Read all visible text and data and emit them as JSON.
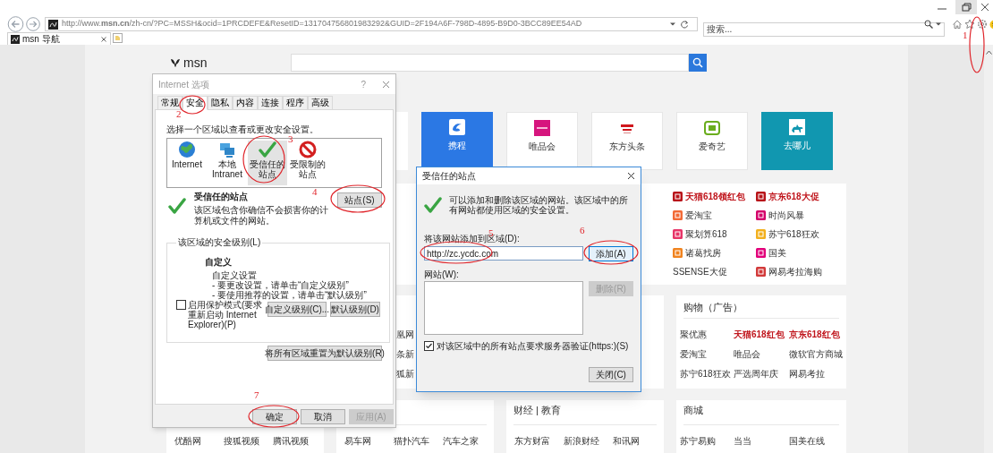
{
  "browser": {
    "address": "http://www.**msn.cn**/zh-cn/?PC=MSSH&ocid=1PRCDEFE&ResetID=131704756801983292&GUID=2F194A6F-798D-4895-B9D0-3BCC89EE54AD",
    "search_placeholder": "搜索...",
    "tabs": [
      {
        "label": "msn 导航",
        "selected": true
      }
    ]
  },
  "page": {
    "logo": "msn",
    "tiles": [
      {
        "label": "携程",
        "color": "#2b78e4"
      },
      {
        "label": "唯品会",
        "color": "#ffffff"
      },
      {
        "label": "东方头条",
        "color": "#ffffff"
      },
      {
        "label": "爱奇艺",
        "color": "#ffffff"
      },
      {
        "label": "去哪儿",
        "color": "#1197b0"
      }
    ],
    "promos": [
      {
        "label": "天猫618领红包",
        "highlight": true,
        "color": "#b8141a"
      },
      {
        "label": "京东618大促",
        "highlight": true,
        "color": "#b8141a"
      },
      {
        "label": "爱淘宝",
        "highlight": false,
        "color": "#f26a36"
      },
      {
        "label": "时尚风暴",
        "highlight": false,
        "color": "#d4006a"
      },
      {
        "label": "聚划算618",
        "highlight": false,
        "color": "#e73568"
      },
      {
        "label": "苏宁618狂欢",
        "highlight": false,
        "color": "#f2b01e"
      },
      {
        "label": "诸葛找房",
        "highlight": false,
        "color": "#f0831f"
      },
      {
        "label": "国美",
        "highlight": false,
        "color": "#e2007a"
      },
      {
        "label": "SSENSE大促",
        "highlight": false
      },
      {
        "label": "网易考拉海购",
        "highlight": false,
        "color": "#d23a3a"
      }
    ],
    "partial_links": [
      "凰网",
      "条新",
      "狐新"
    ],
    "shopping": {
      "title": "购物（广告）",
      "links": [
        {
          "label": "聚优惠",
          "highlight": false
        },
        {
          "label": "天猫618红包",
          "highlight": true
        },
        {
          "label": "京东618红包",
          "highlight": true
        },
        {
          "label": "爱淘宝",
          "highlight": false
        },
        {
          "label": "唯品会",
          "highlight": false
        },
        {
          "label": "微软官方商城",
          "highlight": false
        },
        {
          "label": "苏宁618狂欢",
          "highlight": false
        },
        {
          "label": "严选周年庆",
          "highlight": false
        },
        {
          "label": "网易考拉",
          "highlight": false
        }
      ]
    },
    "sections": [
      {
        "links": [
          "优酷网",
          "搜狐视频",
          "腾讯视频"
        ]
      },
      {
        "links": [
          "易车网",
          "猫扑汽车",
          "汽车之家"
        ]
      },
      {
        "title": "财经 | 教育",
        "links": [
          "东方财富",
          "新浪财经",
          "和讯网"
        ]
      },
      {
        "title": "商城",
        "links": [
          "苏宁易购",
          "当当",
          "国美在线"
        ]
      }
    ]
  },
  "internet_options": {
    "title": "Internet 选项",
    "help": "?",
    "tabs": [
      {
        "label": "常规",
        "selected": false
      },
      {
        "label": "安全",
        "selected": true
      },
      {
        "label": "隐私",
        "selected": false
      },
      {
        "label": "内容",
        "selected": false
      },
      {
        "label": "连接",
        "selected": false
      },
      {
        "label": "程序",
        "selected": false
      },
      {
        "label": "高级",
        "selected": false
      }
    ],
    "prompt": "选择一个区域以查看或更改安全设置。",
    "zones": [
      {
        "label": "Internet",
        "selected": false
      },
      {
        "label": "本地 Intranet",
        "selected": false
      },
      {
        "label": "受信任的站点",
        "selected": true
      },
      {
        "label": "受限制的站点",
        "selected": false
      }
    ],
    "zone_title": "受信任的站点",
    "zone_description": "该区域包含你确信不会损害你的计算机或文件的网站。",
    "sites_button": "站点(S)",
    "level_group": "该区域的安全级别(L)",
    "level_name": "自定义",
    "level_lines": [
      "自定义设置",
      "- 要更改设置，请单击“自定义级别”",
      "- 要使用推荐的设置，请单击“默认级别”"
    ],
    "protected_mode": {
      "label": "启用保护模式(要求重新启动 Internet Explorer)(P)",
      "checked": false
    },
    "level_buttons": [
      "自定义级别(C)...",
      "默认级别(D)"
    ],
    "reset_button": "将所有区域重置为默认级别(R)",
    "buttons": [
      {
        "label": "确定",
        "disabled": false
      },
      {
        "label": "取消",
        "disabled": false
      },
      {
        "label": "应用(A)",
        "disabled": true
      }
    ]
  },
  "trusted_sites": {
    "title": "受信任的站点",
    "description": "可以添加和删除该区域的网站。该区域中的所有网站都使用区域的安全设置。",
    "add_label": "将该网站添加到区域(D):",
    "url": "http://zc.ycdc.com",
    "add_button": "添加(A)",
    "sites_label": "网站(W):",
    "remove_button": {
      "label": "删除(R)",
      "disabled": true
    },
    "require_https": {
      "label": "对该区域中的所有站点要求服务器验证(https:)(S)",
      "checked": true
    },
    "close_button": "关闭(C)"
  },
  "annotations": [
    {
      "label": "1"
    },
    {
      "label": "2"
    },
    {
      "label": "3"
    },
    {
      "label": "4"
    },
    {
      "label": "5"
    },
    {
      "label": "6"
    },
    {
      "label": "7"
    }
  ]
}
